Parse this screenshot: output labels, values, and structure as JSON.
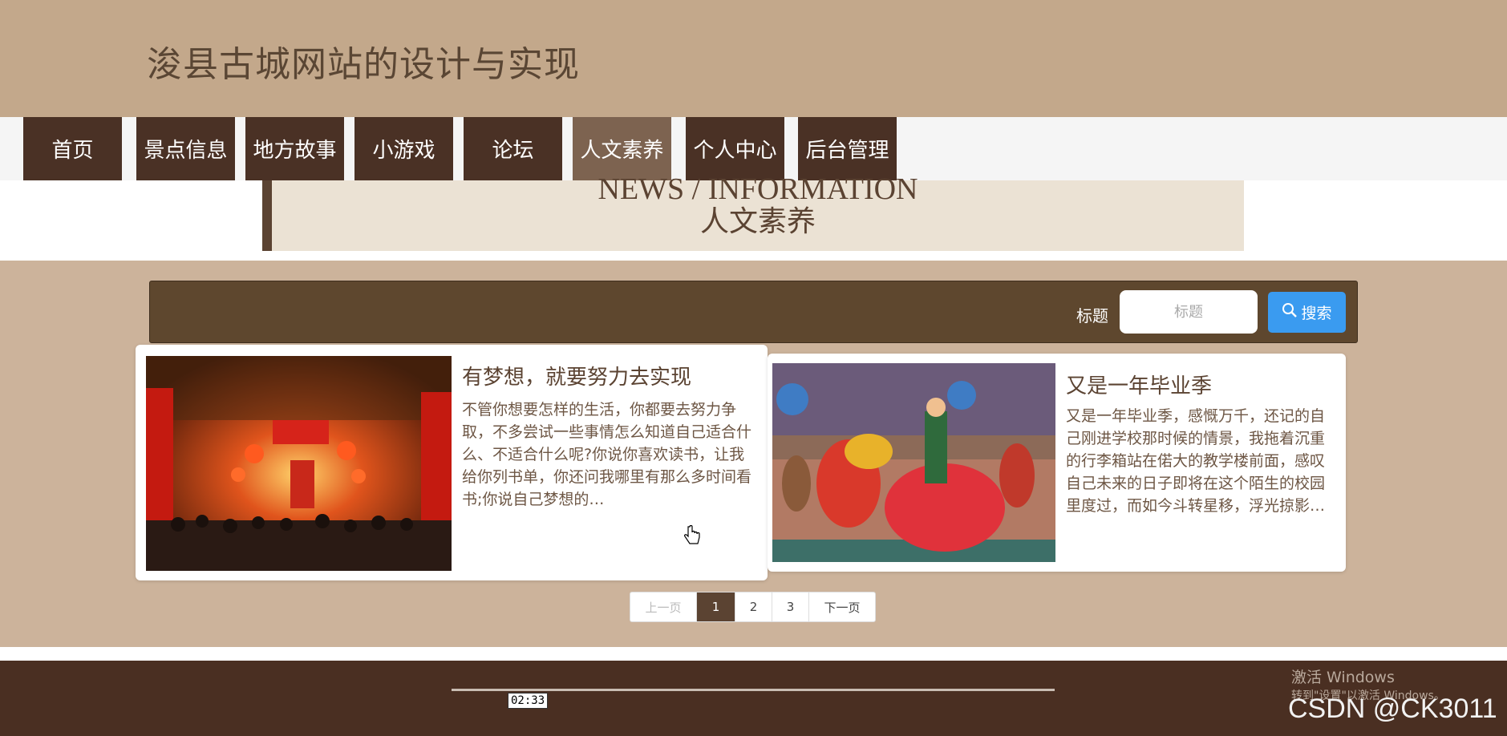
{
  "site": {
    "title": "浚县古城网站的设计与实现"
  },
  "nav": {
    "items": [
      {
        "label": "首页"
      },
      {
        "label": "景点信息"
      },
      {
        "label": "地方故事"
      },
      {
        "label": "小游戏"
      },
      {
        "label": "论坛"
      },
      {
        "label": "人文素养",
        "active": true
      },
      {
        "label": "个人中心"
      },
      {
        "label": "后台管理"
      }
    ]
  },
  "banner": {
    "en": "NEWS / INFORMATION",
    "cn": "人文素养"
  },
  "search": {
    "label": "标题",
    "placeholder": "标题",
    "button": "搜索"
  },
  "articles": [
    {
      "title": "有梦想，就要努力去实现",
      "excerpt": "不管你想要怎样的生活，你都要去努力争取，不多尝试一些事情怎么知道自己适合什么、不适合什么呢?你说你喜欢读书，让我给你列书单，你还问我哪里有那么多时间看书;你说自己梦想的…",
      "image": "red-lantern-street-photo"
    },
    {
      "title": "又是一年毕业季",
      "excerpt": "又是一年毕业季，感慨万千，还记的自己刚进学校那时候的情景，我拖着沉重的行李箱站在偌大的教学楼前面，感叹自己未来的日子即将在这个陌生的校园里度过，而如今斗转星移，浮光掠影…",
      "image": "folk-dance-performance-photo"
    }
  ],
  "pagination": {
    "prev": "上一页",
    "pages": [
      "1",
      "2",
      "3"
    ],
    "current": "1",
    "next": "下一页"
  },
  "player": {
    "time": "02:33"
  },
  "overlay": {
    "windows_activate": "激活 Windows",
    "windows_hint": "转到\"设置\"以激活 Windows。",
    "watermark": "CSDN @CK3011"
  },
  "colors": {
    "header": "#c3a88b",
    "nav": "#4a3125",
    "nav_active": "#7d6350",
    "main": "#ccb39b",
    "footer": "#4a2f22",
    "search_btn": "#3a9bf0"
  }
}
